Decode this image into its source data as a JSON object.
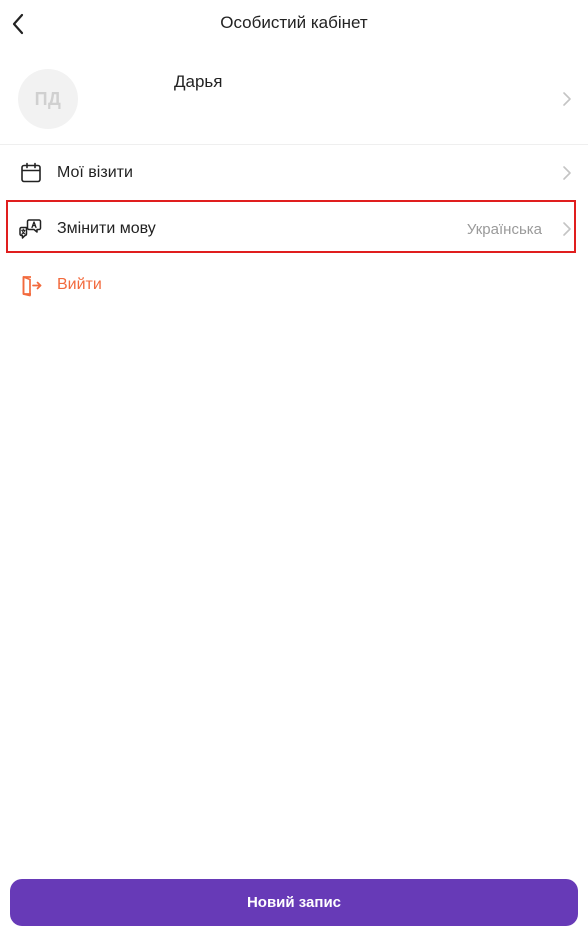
{
  "header": {
    "title": "Особистий кабінет",
    "back_icon": "chevron-left-icon"
  },
  "profile": {
    "initials": "ПД",
    "name": "Дарья"
  },
  "menu": {
    "visits": {
      "label": "Мої візити",
      "icon": "calendar-icon"
    },
    "language": {
      "label": "Змінити мову",
      "value": "Українська",
      "icon": "translate-icon"
    },
    "logout": {
      "label": "Вийти",
      "icon": "logout-icon",
      "color": "#f26a3d"
    }
  },
  "footer": {
    "new_booking_label": "Новий запис",
    "button_color": "#673ab7"
  },
  "colors": {
    "highlight_border": "#e01e1e"
  }
}
